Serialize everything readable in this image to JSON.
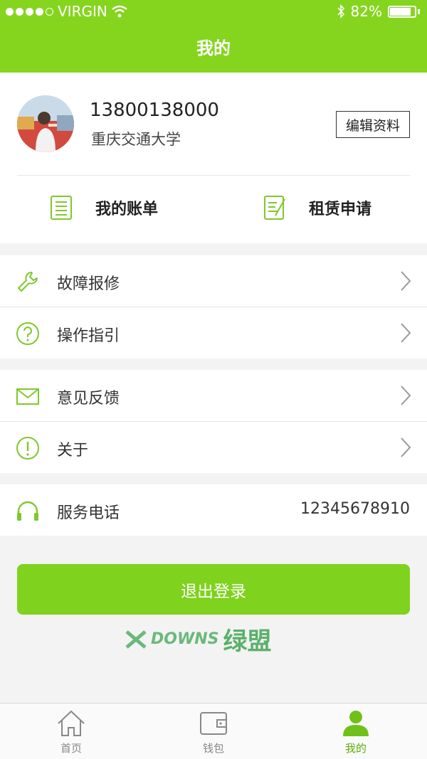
{
  "status_bar": {
    "carrier": "VIRGIN",
    "battery": "82%",
    "battery_level": 0.82
  },
  "header": {
    "title": "我的"
  },
  "profile": {
    "phone": "13800138000",
    "school": "重庆交通大学",
    "edit_label": "编辑资料",
    "avatar_icon": "user-photo"
  },
  "quick_actions": [
    {
      "label": "我的账单",
      "icon": "bill-icon"
    },
    {
      "label": "租赁申请",
      "icon": "apply-icon"
    }
  ],
  "menu": {
    "repair": "故障报修",
    "guide": "操作指引",
    "feedback": "意见反馈",
    "about": "关于",
    "service_label": "服务电话",
    "service_phone": "12345678910"
  },
  "logout_label": "退出登录",
  "watermark": {
    "en": "DOWNS",
    "cn": "绿盟"
  },
  "tabbar": [
    {
      "label": "首页",
      "icon": "home-icon"
    },
    {
      "label": "钱包",
      "icon": "wallet-icon"
    },
    {
      "label": "我的",
      "icon": "profile-icon",
      "active": true
    }
  ],
  "colors": {
    "brand_green": "#85d51f",
    "button_green": "#7fd21d"
  }
}
